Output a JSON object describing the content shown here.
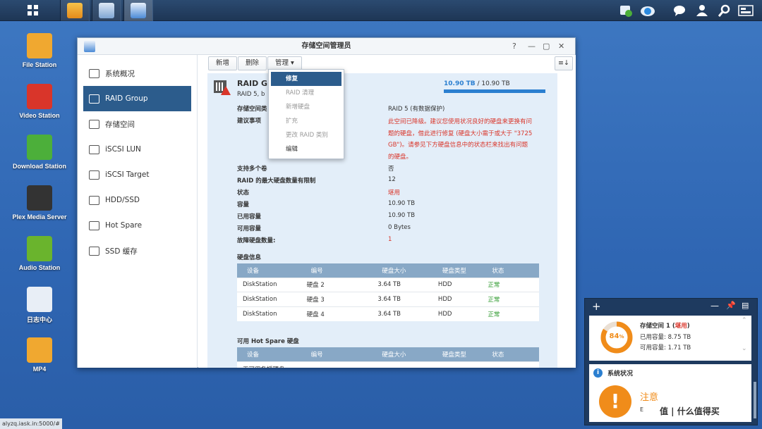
{
  "taskbar": {
    "icons": [
      "main-menu-icon",
      "file-station-icon",
      "control-panel-icon",
      "storage-manager-icon"
    ],
    "tray": [
      "backup-icon",
      "cloud-sync-icon",
      "chat-icon",
      "user-icon",
      "search-icon",
      "widgets-icon"
    ]
  },
  "desktop": {
    "icons": [
      {
        "label": "File Station",
        "icon": "file-station-icon",
        "color": "#f0a830"
      },
      {
        "label": "Video Station",
        "icon": "video-station-icon",
        "color": "#d9352a"
      },
      {
        "label": "Download Station",
        "icon": "download-station-icon",
        "color": "#4caf3a"
      },
      {
        "label": "Plex Media Server",
        "icon": "plex-icon",
        "color": "#333333"
      },
      {
        "label": "Audio Station",
        "icon": "audio-station-icon",
        "color": "#6ab42d"
      },
      {
        "label": "日志中心",
        "icon": "log-center-icon",
        "color": "#e8eef6"
      },
      {
        "label": "MP4",
        "icon": "folder-icon",
        "color": "#f0a830"
      }
    ]
  },
  "window": {
    "title": "存储空间管理员",
    "help": "?",
    "nav": [
      "系统概况",
      "RAID Group",
      "存储空间",
      "iSCSI LUN",
      "iSCSI Target",
      "HDD/SSD",
      "Hot Spare",
      "SSD 缓存"
    ],
    "toolbar": {
      "create": "新增",
      "delete": "删除",
      "manage": "管理 ▾"
    },
    "raid": {
      "title": "RAID Gr",
      "subtitle": "RAID 5, b",
      "capacity_text": "10.90 TB",
      "capacity_total": " / 10.90 TB",
      "usage_fraction": 1.0
    },
    "menu": [
      "修复",
      "RAID 清理",
      "新增硬盘",
      "扩充",
      "更改 RAID 类别",
      "编辑"
    ],
    "details": {
      "type_label": "存储空间类",
      "type_value": "RAID 5 (有数据保护)",
      "advice_label": "建议事项",
      "advice_lines": [
        "此空间已降级。建议您使用状况良好的硬盘来更换有问",
        "题的硬盘，借此进行修复 (硬盘大小需于或大于 \"3725",
        "GB\")。请参见下方硬盘信息中的状态栏来找出有问题",
        "的硬盘。"
      ],
      "multi_label": "支持多个卷",
      "multi_value": "否",
      "maxdisk_label": "RAID 的最大硬盘数量有限制",
      "maxdisk_value": "12",
      "status_label": "状态",
      "status_value": "堪用",
      "capacity_label": "容量",
      "capacity_value": "10.90 TB",
      "used_label": "已用容量",
      "used_value": "10.90 TB",
      "avail_label": "可用容量",
      "avail_value": "0 Bytes",
      "failed_label": "故障硬盘数量:",
      "failed_value": "1"
    },
    "disk_info": {
      "title": "硬盘信息",
      "headers": [
        "设备",
        "编号",
        "硬盘大小",
        "硬盘类型",
        "状态"
      ],
      "rows": [
        [
          "DiskStation",
          "硬盘 2",
          "3.64 TB",
          "HDD",
          "正常"
        ],
        [
          "DiskStation",
          "硬盘 3",
          "3.64 TB",
          "HDD",
          "正常"
        ],
        [
          "DiskStation",
          "硬盘 4",
          "3.64 TB",
          "HDD",
          "正常"
        ]
      ]
    },
    "hotspare": {
      "title": "可用 Hot Spare 硬盘",
      "headers": [
        "设备",
        "编号",
        "硬盘大小",
        "硬盘类型",
        "状态"
      ],
      "empty": "无可用备援硬盘。"
    }
  },
  "widget": {
    "storage_title": "存储空间 1 (",
    "storage_status": "堪用",
    "storage_close": ")",
    "percent": "84",
    "percent_sign": "%",
    "used": "已用容量: 8.75 TB",
    "avail": "可用容量: 1.71 TB",
    "health_title": "系统状况",
    "alert": "注意",
    "alert_sub": "E"
  },
  "url": "alyzq.iask.in:5000/#",
  "watermark": "值 | 什么值得买"
}
